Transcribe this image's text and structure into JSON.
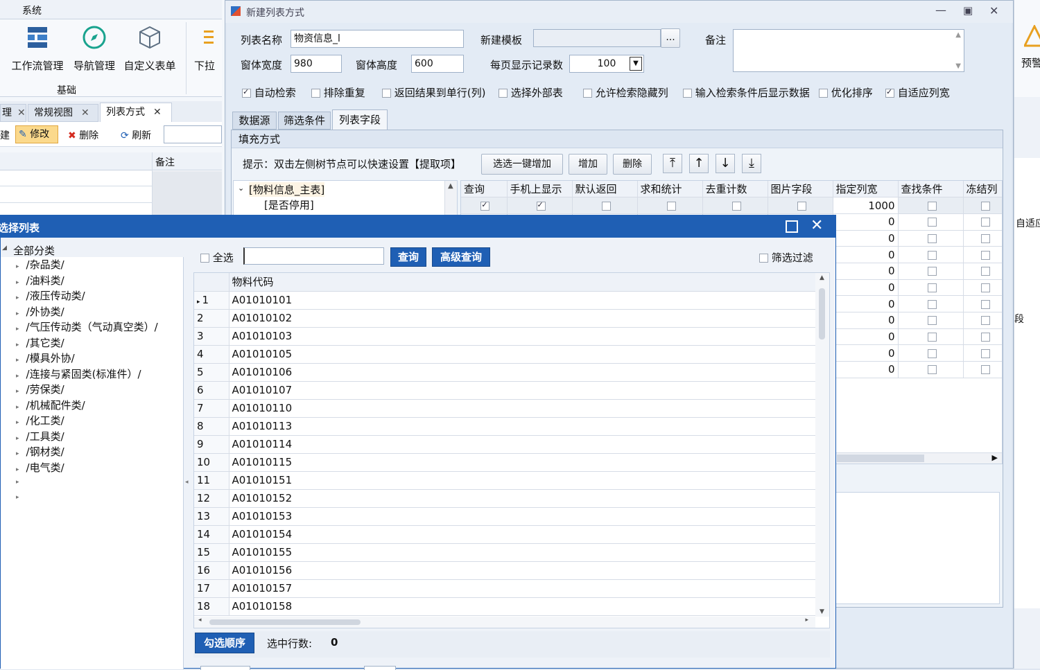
{
  "bg": {
    "menu": "系统",
    "ribbon": [
      {
        "label": "工作流管理"
      },
      {
        "label": "导航管理"
      },
      {
        "label": "自定义表单"
      },
      {
        "label": "下拉"
      }
    ],
    "ribbon_group": "基础",
    "right_ribbon_label": "预警",
    "tabs": [
      {
        "label": "理"
      },
      {
        "label": "常规视图"
      },
      {
        "label": "列表方式"
      }
    ],
    "toolbar": {
      "new": "建",
      "edit": "修改",
      "delete": "删除",
      "refresh": "刷新"
    },
    "grid_header": "备注",
    "right_text1": "自适应",
    "right_text2": "段"
  },
  "dlg": {
    "title": "新建列表方式",
    "labels": {
      "name": "列表名称",
      "template": "新建模板",
      "remark": "备注",
      "width": "窗体宽度",
      "height": "窗体高度",
      "pagesize": "每页显示记录数"
    },
    "values": {
      "name": "物资信息_l",
      "width": "980",
      "height": "600",
      "pagesize": "100",
      "template": ""
    },
    "ellipsis": "...",
    "checks": [
      {
        "label": "自动检索",
        "on": true
      },
      {
        "label": "排除重复",
        "on": false
      },
      {
        "label": "返回结果到单行(列)",
        "on": false
      },
      {
        "label": "选择外部表",
        "on": false
      },
      {
        "label": "允许检索隐藏列",
        "on": false
      },
      {
        "label": "输入检索条件后显示数据",
        "on": false
      },
      {
        "label": "优化排序",
        "on": false
      },
      {
        "label": "自适应列宽",
        "on": true
      }
    ],
    "tabs": [
      "数据源",
      "筛选条件",
      "列表字段"
    ],
    "fill_mode": "填充方式",
    "hint": "提示：双击左侧树节点可以快速设置【提取项】",
    "buttons": {
      "batch_add": "选选一键增加",
      "add": "增加",
      "delete": "删除"
    },
    "tree": {
      "root": "[物料信息_主表]",
      "child": "[是否停用]"
    },
    "columns": [
      "查询",
      "手机上显示",
      "默认返回",
      "求和统计",
      "去重计数",
      "图片字段",
      "指定列宽",
      "查找条件",
      "冻结列"
    ],
    "widths": [
      "1000",
      "0",
      "0",
      "0",
      "0",
      "0",
      "0",
      "0",
      "0",
      "0",
      "0"
    ]
  },
  "sel": {
    "title": "选择列表",
    "tree_root": "全部分类",
    "categories": [
      "/杂品类/",
      "/油料类/",
      "/液压传动类/",
      "/外协类/",
      "/气压传动类（气动真空类）/",
      "/其它类/",
      "/模具外协/",
      "/连接与紧固类(标准件）/",
      "/劳保类/",
      "/机械配件类/",
      "/化工类/",
      "/工具类/",
      "/钢材类/",
      "/电气类/"
    ],
    "select_all": "全选",
    "search_value": "",
    "query": "查询",
    "advanced_query": "高级查询",
    "filter": "筛选过滤",
    "column": "物料代码",
    "rows": [
      {
        "n": "1",
        "code": "A01010101"
      },
      {
        "n": "2",
        "code": "A01010102"
      },
      {
        "n": "3",
        "code": "A01010103"
      },
      {
        "n": "4",
        "code": "A01010105"
      },
      {
        "n": "5",
        "code": "A01010106"
      },
      {
        "n": "6",
        "code": "A01010107"
      },
      {
        "n": "7",
        "code": "A01010110"
      },
      {
        "n": "8",
        "code": "A01010113"
      },
      {
        "n": "9",
        "code": "A01010114"
      },
      {
        "n": "10",
        "code": "A01010115"
      },
      {
        "n": "11",
        "code": "A01010151"
      },
      {
        "n": "12",
        "code": "A01010152"
      },
      {
        "n": "13",
        "code": "A01010153"
      },
      {
        "n": "14",
        "code": "A01010154"
      },
      {
        "n": "15",
        "code": "A01010155"
      },
      {
        "n": "16",
        "code": "A01010156"
      },
      {
        "n": "17",
        "code": "A01010157"
      },
      {
        "n": "18",
        "code": "A01010158"
      }
    ],
    "order_btn": "勾选顺序",
    "selected_label": "选中行数:",
    "selected_count": "0"
  },
  "colors": {
    "accent": "#1f5fb4"
  }
}
